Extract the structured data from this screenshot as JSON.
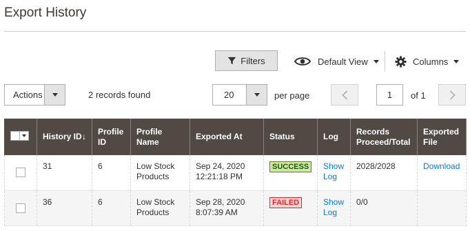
{
  "page": {
    "title": "Export History"
  },
  "toolbar": {
    "filters_label": "Filters",
    "view_label": "Default View",
    "columns_label": "Columns",
    "actions_label": "Actions",
    "records_found": "2 records found",
    "per_page_value": "20",
    "per_page_label": "per page",
    "current_page": "1",
    "page_of": "of 1"
  },
  "icons": {
    "filter": "filter-icon",
    "eye": "eye-icon",
    "gear": "gear-icon",
    "prev": "chevron-left-icon",
    "next": "chevron-right-icon",
    "sort": "sort-down-arrow"
  },
  "colors": {
    "header_bg": "#514943",
    "link": "#007bdb",
    "success_bg": "#d0e5a9",
    "success_text": "#185b00",
    "failed_bg": "#f9d4d4",
    "failed_text": "#e22626"
  },
  "grid": {
    "columns": [
      {
        "key": "history_id",
        "label": "History ID",
        "sort": "↓"
      },
      {
        "key": "profile_id",
        "label": "Profile ID"
      },
      {
        "key": "profile_name",
        "label": "Profile Name"
      },
      {
        "key": "exported_at",
        "label": "Exported At"
      },
      {
        "key": "status",
        "label": "Status"
      },
      {
        "key": "log",
        "label": "Log"
      },
      {
        "key": "records",
        "label": "Records Proceed/Total"
      },
      {
        "key": "exported_file",
        "label": "Exported File"
      }
    ],
    "rows": [
      {
        "history_id": "31",
        "profile_id": "6",
        "profile_name": "Low Stock Products",
        "exported_at": "Sep 24, 2020 12:21:18 PM",
        "status": "SUCCESS",
        "log": "Show Log",
        "records": "2028/2028",
        "exported_file": "Download"
      },
      {
        "history_id": "36",
        "profile_id": "6",
        "profile_name": "Low Stock Products",
        "exported_at": "Sep 28, 2020 8:07:39 AM",
        "status": "FAILED",
        "log": "Show Log",
        "records": "0/0",
        "exported_file": ""
      }
    ]
  }
}
